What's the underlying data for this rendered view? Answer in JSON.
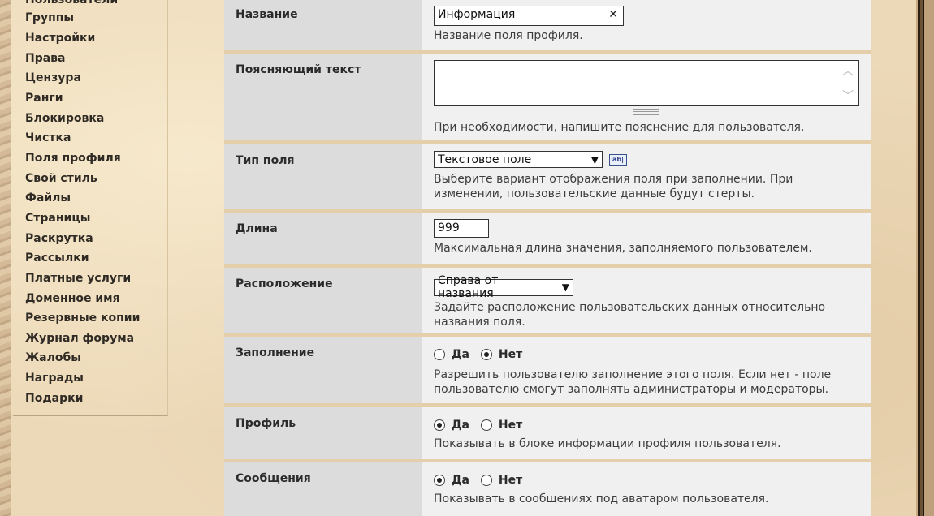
{
  "sidebar": {
    "items": [
      {
        "label": "Пользователи"
      },
      {
        "label": "Группы"
      },
      {
        "label": "Настройки"
      },
      {
        "label": "Права"
      },
      {
        "label": "Цензура"
      },
      {
        "label": "Ранги"
      },
      {
        "label": "Блокировка"
      },
      {
        "label": "Чистка"
      },
      {
        "label": "Поля профиля"
      },
      {
        "label": "Свой стиль"
      },
      {
        "label": "Файлы"
      },
      {
        "label": "Страницы"
      },
      {
        "label": "Раскрутка"
      },
      {
        "label": "Рассылки"
      },
      {
        "label": "Платные услуги"
      },
      {
        "label": "Доменное имя"
      },
      {
        "label": "Резервные копии"
      },
      {
        "label": "Журнал форума"
      },
      {
        "label": "Жалобы"
      },
      {
        "label": "Награды"
      },
      {
        "label": "Подарки"
      }
    ]
  },
  "form": {
    "name": {
      "label": "Название",
      "value": "Информация",
      "hint": "Название поля профиля."
    },
    "explain": {
      "label": "Поясняющий текст",
      "value": "",
      "hint": "При необходимости, напишите пояснение для пользователя."
    },
    "type": {
      "label": "Тип поля",
      "selected": "Текстовое поле",
      "icon_text": "ab|",
      "hint": "Выберите вариант отображения поля при заполнении. При изменении, пользовательские данные будут стерты."
    },
    "length": {
      "label": "Длина",
      "value": "999",
      "hint": "Максимальная длина значения, заполняемого пользователем."
    },
    "position": {
      "label": "Расположение",
      "selected": "Справа от названия",
      "hint": "Задайте расположение пользовательских данных относительно названия поля."
    },
    "filling": {
      "label": "Заполнение",
      "yes": "Да",
      "no": "Нет",
      "selected": "no",
      "hint": "Разрешить пользователю заполнение этого поля. Если нет - поле пользователю смогут заполнять администраторы и модераторы."
    },
    "profile": {
      "label": "Профиль",
      "yes": "Да",
      "no": "Нет",
      "selected": "yes",
      "hint": "Показывать в блоке информации профиля пользователя."
    },
    "messages": {
      "label": "Сообщения",
      "yes": "Да",
      "no": "Нет",
      "selected": "yes",
      "hint": "Показывать в сообщениях под аватаром пользователя."
    }
  },
  "colors": {
    "label_bg": "#dcdcdc",
    "value_bg": "#f0f0f0",
    "separator": "#e5cfab",
    "parchment": "#ecd9b8"
  }
}
